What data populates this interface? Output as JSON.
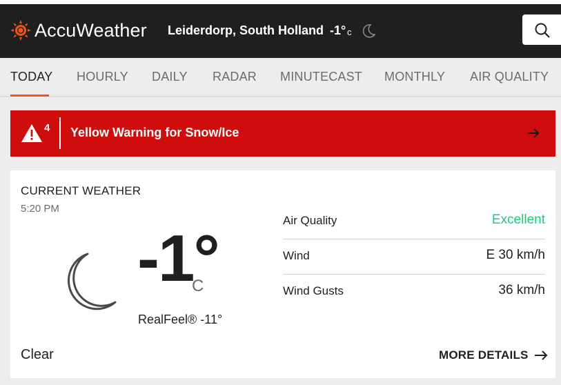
{
  "header": {
    "brand": "AccuWeather",
    "location": "Leiderdorp, South Holland",
    "temp": "-1°",
    "unit": "c",
    "condition_icon": "moon-icon",
    "search_icon": "search-icon"
  },
  "nav": {
    "tabs": [
      {
        "label": "TODAY",
        "active": true
      },
      {
        "label": "HOURLY"
      },
      {
        "label": "DAILY"
      },
      {
        "label": "RADAR"
      },
      {
        "label": "MINUTECAST"
      },
      {
        "label": "MONTHLY"
      },
      {
        "label": "AIR QUALITY"
      }
    ]
  },
  "alert": {
    "count": "4",
    "text": "Yellow Warning for Snow/Ice",
    "color": "#d00d0d"
  },
  "current": {
    "title": "CURRENT WEATHER",
    "time": "5:20 PM",
    "temp": "-1°",
    "unit": "C",
    "realfeel": "RealFeel® -11°",
    "condition": "Clear",
    "details": [
      {
        "label": "Air Quality",
        "value": "Excellent"
      },
      {
        "label": "Wind",
        "value": "E 30 km/h"
      },
      {
        "label": "Wind Gusts",
        "value": "36 km/h"
      }
    ],
    "more_label": "MORE DETAILS"
  },
  "colors": {
    "accent": "#f05514",
    "alert_red": "#d00d0d",
    "good_green": "#1dc97b",
    "header_bg": "#1f1f1f"
  }
}
